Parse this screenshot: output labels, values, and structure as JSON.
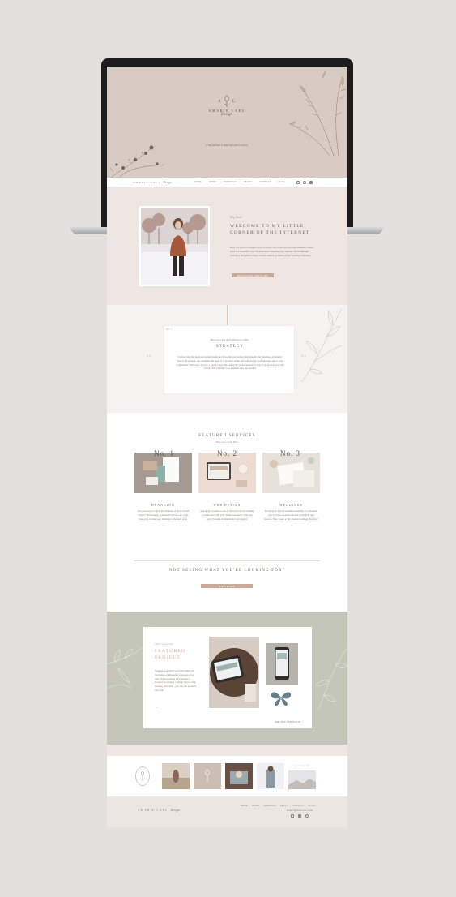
{
  "brand": {
    "name": "AMARIE LAEL",
    "script": "Design",
    "monogram": "A L",
    "tagline": "A BRANDING & WEB DESIGN STUDIO"
  },
  "nav": {
    "links": [
      "HOME",
      "WORK",
      "SERVICES",
      "ABOUT",
      "CONTACT",
      "BLOG"
    ],
    "social_icons": [
      "instagram-icon",
      "pinterest-icon",
      "facebook-icon"
    ]
  },
  "welcome": {
    "eyebrow": "Hey there!",
    "title_line1": "WELCOME TO MY LITTLE",
    "title_line2": "CORNER OF THE INTERNET",
    "body": "Here, my goal is to inspire your creativity and to tell you and your business' unique story in a beautiful way. I'm dedicated to helping you, whether that be through creating a thoughtful brand, custom website, or hand-crafted wedding stationery.",
    "button": "READ MORE ABOUT ME"
  },
  "offer": {
    "number": "No. 1",
    "intro": "Here are a few of the Wellness I offer...",
    "title": "STRATEGY",
    "body": "I believe that the most successful brands are those that are crafted with thought and intention. A strategic brand will speak to the strengths and heart of your ideal clients and will present your business above your competition. With every project, I spend ample time doing the initial research so that I can provide you with a brand that will take your business into step further.",
    "prev_arrow": "« «",
    "next_arrow": "» »"
  },
  "featured_services": {
    "title": "FEATURED SERVICES",
    "subtitle": "How can I help You?",
    "cards": [
      {
        "number": "No. 1",
        "title": "BRANDING",
        "body": "Are you ready to catch the attention of those dream clients? Investing in a polished brand is one of the best ways to take your business to the next level.",
        "arrow": "→"
      },
      {
        "number": "No. 2",
        "title": "WEB DESIGN",
        "body": "A strategic website is one of the best tools for making a connection with your dream customers. Tell your story through an intentional web design!",
        "arrow": "→"
      },
      {
        "number": "No. 3",
        "title": "WEDDINGS",
        "body": "Investing in custom wedding stationery is a beautiful way to create an heirloom that you'll hold dear forever. Take a peek at my custom wedding offerings!",
        "arrow": "→"
      }
    ],
    "not_seeing": "NOT SEEING WHAT YOU'RE LOOKING FOR?",
    "button": "VIEW MORE"
  },
  "featured_project": {
    "eyebrow": "Take a peek at the",
    "title_line1": "FEATURED",
    "title_line2": "PROJECT",
    "body": "Scripture Celluloid: powerful music lift the homes of thousands of people of all ages. When creating their website I focused on creating a design that is calm, inviting, and clean - just like the products they sell.",
    "arrow": "→",
    "portfolio_link": "SEE OUR PORTFOLIO →"
  },
  "instagram": {
    "handle": "FOLLOW ALONG",
    "handle2": "@AMARIELAELDESIGN"
  },
  "footer": {
    "brand": "AMARIE LAEL",
    "script": "Design",
    "links": [
      "HOME",
      "WORK",
      "SERVICES",
      "ABOUT",
      "CONTACT",
      "BLOG"
    ],
    "email": "amarie@amarielael.com",
    "social_icons": [
      "instagram-icon",
      "facebook-icon",
      "pinterest-icon"
    ]
  },
  "colors": {
    "background": "#e4e0dd",
    "hero": "#d7cbc3",
    "blush": "#ede6e2",
    "sage": "#c3c6b9",
    "accent": "#c8a99a",
    "footer": "#ece6e2"
  }
}
